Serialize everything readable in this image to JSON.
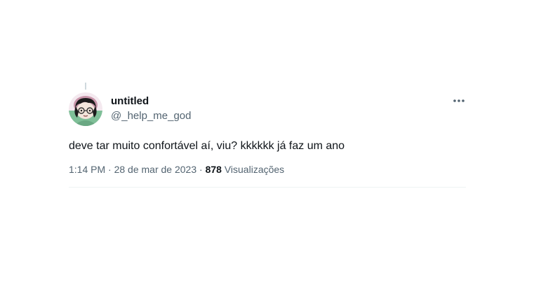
{
  "tweet": {
    "display_name": "untitled",
    "handle": "@_help_me_god",
    "text": "deve tar muito confortável aí, viu? kkkkkk já faz um ano",
    "time": "1:14 PM",
    "separator": "·",
    "date": "28 de mar de 2023",
    "views_count": "878",
    "views_label": "Visualizações",
    "avatar_icon": "avatar-cartoon-girl-icon",
    "more_icon": "more-options-icon"
  },
  "colors": {
    "text_primary": "#0f1419",
    "text_secondary": "#536471",
    "divider": "#eff3f4"
  }
}
